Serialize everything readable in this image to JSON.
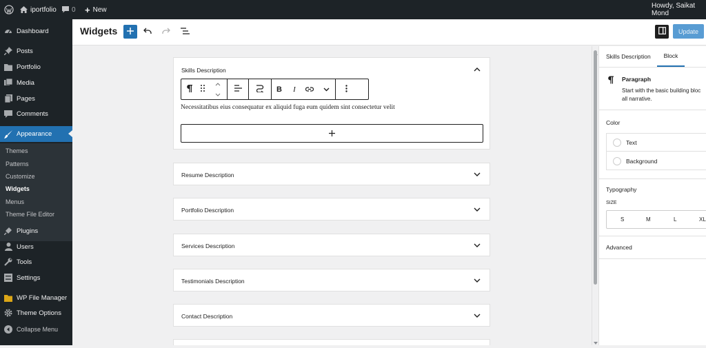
{
  "admin_bar": {
    "site_name": "iportfolio",
    "comments_count": "0",
    "new_label": "New",
    "howdy": "Howdy, Saikat Mond"
  },
  "sidebar": {
    "items": [
      {
        "label": "Dashboard",
        "icon": "dashboard-icon"
      },
      {
        "label": "Posts",
        "icon": "pin-icon"
      },
      {
        "label": "Portfolio",
        "icon": "folder-icon"
      },
      {
        "label": "Media",
        "icon": "media-icon"
      },
      {
        "label": "Pages",
        "icon": "pages-icon"
      },
      {
        "label": "Comments",
        "icon": "comment-icon"
      },
      {
        "label": "Appearance",
        "icon": "brush-icon"
      },
      {
        "label": "Plugins",
        "icon": "plugin-icon"
      },
      {
        "label": "Users",
        "icon": "user-icon"
      },
      {
        "label": "Tools",
        "icon": "wrench-icon"
      },
      {
        "label": "Settings",
        "icon": "settings-icon"
      },
      {
        "label": "WP File Manager",
        "icon": "file-manager-icon"
      },
      {
        "label": "Theme Options",
        "icon": "gear-icon"
      },
      {
        "label": "Collapse Menu",
        "icon": "collapse-icon"
      }
    ],
    "submenu": [
      "Themes",
      "Patterns",
      "Customize",
      "Widgets",
      "Menus",
      "Theme File Editor"
    ]
  },
  "header": {
    "title": "Widgets",
    "update_label": "Update"
  },
  "editor": {
    "open_panel": {
      "title": "Skills Description",
      "paragraph": "Necessitatibus eius consequatur ex aliquid fuga eum quidem sint consectetur velit"
    },
    "panels": [
      "Resume Description",
      "Portfolio Description",
      "Services Description",
      "Testimonials Description",
      "Contact Description"
    ],
    "toolbar_bold": "B",
    "toolbar_italic": "I"
  },
  "settings": {
    "tabs": [
      "Skills Description",
      "Block"
    ],
    "block_name": "Paragraph",
    "block_description": "Start with the basic building bloc",
    "block_description_2": "all narrative.",
    "color_title": "Color",
    "color_options": [
      "Text",
      "Background"
    ],
    "typography_title": "Typography",
    "size_label": "SIZE",
    "sizes": [
      "S",
      "M",
      "L",
      "XL"
    ],
    "advanced_title": "Advanced"
  },
  "colors": {
    "admin_dark": "#1d2327",
    "accent": "#2271b1"
  }
}
